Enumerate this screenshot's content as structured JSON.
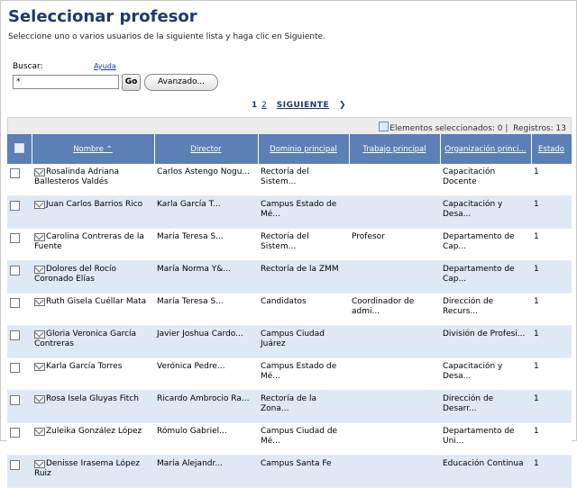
{
  "page": {
    "title": "Seleccionar profesor",
    "subtitle": "Seleccione uno o varios usuarios de la siguiente lista y haga clic en Siguiente."
  },
  "search": {
    "label": "Buscar:",
    "help": "Ayuda",
    "value": "*",
    "go": "Go",
    "advanced": "Avanzado..."
  },
  "pager": {
    "current": "1",
    "page2": "2",
    "next": "SIGUIENTE",
    "arrow": "❯"
  },
  "selection": {
    "text": "Elementos seleccionados: 0 |",
    "records": "Registros: 13"
  },
  "columns": [
    "Nombre ⌃",
    "Director",
    "Dominio principal",
    "Trabajo principal",
    "Organización princi...",
    "Estado"
  ],
  "rows": [
    {
      "name": "Rosalinda Adriana Ballesteros Valdés",
      "director": "Carlos Astengo Nogu...",
      "dominio": "Rectoría del Sistem...",
      "trabajo": "",
      "org": "Capacitación Docente",
      "estado": "1"
    },
    {
      "name": "Juan Carlos Barrios Rico",
      "director": "Karla García T...",
      "dominio": "Campus Estado de Mé...",
      "trabajo": "",
      "org": "Capacitación y Desa...",
      "estado": "1"
    },
    {
      "name": "Carolina Contreras de la Fuente",
      "director": "María Teresa S...",
      "dominio": "Rectoría del Sistem...",
      "trabajo": "Profesor",
      "org": "Departamento de Cap...",
      "estado": "1"
    },
    {
      "name": "Dolores del Rocío Coronado Elías",
      "director": "María Norma Y&...",
      "dominio": "Rectoría de la ZMM",
      "trabajo": "",
      "org": "Departamento de Cap...",
      "estado": "1"
    },
    {
      "name": "Ruth Gisela Cuéllar Mata",
      "director": "María Teresa S...",
      "dominio": "Candidatos",
      "trabajo": "Coordinador de admi...",
      "org": "Dirección de Recurs...",
      "estado": "1"
    },
    {
      "name": "Gloria Veronica García Contreras",
      "director": "Javier Joshua Cardo...",
      "dominio": "Campus Ciudad Juárez",
      "trabajo": "",
      "org": "División de Profesi...",
      "estado": "1"
    },
    {
      "name": "Karla García Torres",
      "director": "Verónica Pedre...",
      "dominio": "Campus Estado de Mé...",
      "trabajo": "",
      "org": "Capacitación y Desa...",
      "estado": "1"
    },
    {
      "name": "Rosa Isela Gluyas Fitch",
      "director": "Ricardo Ambrocio Ra...",
      "dominio": "Rectoría de la Zona...",
      "trabajo": "",
      "org": "Dirección de Desarr...",
      "estado": "1"
    },
    {
      "name": "Zuleika González López",
      "director": "Rómulo Gabriel...",
      "dominio": "Campus Ciudad de Mé...",
      "trabajo": "",
      "org": "Departamento de Uni...",
      "estado": "1"
    },
    {
      "name": "Denisse Irasema López Ruiz",
      "director": "María Alejandr...",
      "dominio": "Campus Santa Fe",
      "trabajo": "",
      "org": "Educación Continua",
      "estado": "1"
    }
  ]
}
